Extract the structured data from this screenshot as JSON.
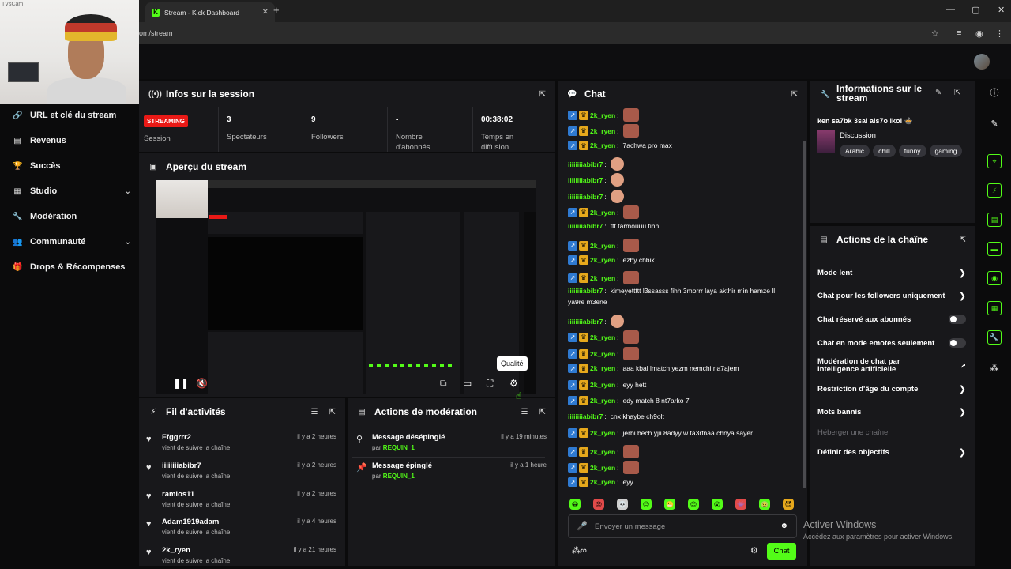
{
  "browser": {
    "tab_title": "Stream - Kick Dashboard",
    "tab_close": "✕",
    "new_tab": "+",
    "url": "om/stream",
    "window_controls": [
      "—",
      "▢",
      "✕"
    ]
  },
  "webcam": {
    "watermark": "TVsCam"
  },
  "sidebar": {
    "items": [
      {
        "label": "URL et clé du stream",
        "icon": "link-icon"
      },
      {
        "label": "Revenus",
        "icon": "bar-chart-icon"
      },
      {
        "label": "Succès",
        "icon": "trophy-icon"
      },
      {
        "label": "Studio",
        "icon": "studio-icon",
        "chevron": true
      },
      {
        "label": "Modération",
        "icon": "wrench-icon"
      },
      {
        "label": "Communauté",
        "icon": "community-icon",
        "chevron": true
      },
      {
        "label": "Drops & Récompenses",
        "icon": "gift-icon"
      }
    ]
  },
  "session": {
    "title": "Infos sur la session",
    "status": "STREAMING",
    "status_label": "Session",
    "stats": [
      {
        "value": "3",
        "label": "Spectateurs"
      },
      {
        "value": "9",
        "label": "Followers"
      },
      {
        "value": "-",
        "label": "Nombre d'abonnés"
      },
      {
        "value": "00:38:02",
        "label": "Temps en diffusion"
      }
    ]
  },
  "preview": {
    "title": "Aperçu du stream",
    "tooltip": "Qualité"
  },
  "activity": {
    "title": "Fil d'activités",
    "items": [
      {
        "name": "Ffggrrr2",
        "sub": "vient de suivre la chaîne",
        "time": "il y a 2 heures"
      },
      {
        "name": "iiiiiiiiabibr7",
        "sub": "vient de suivre la chaîne",
        "time": "il y a 2 heures"
      },
      {
        "name": "ramios11",
        "sub": "vient de suivre la chaîne",
        "time": "il y a 2 heures"
      },
      {
        "name": "Adam1919adam",
        "sub": "vient de suivre la chaîne",
        "time": "il y a 4 heures"
      },
      {
        "name": "2k_ryen",
        "sub": "vient de suivre la chaîne",
        "time": "il y a 21 heures"
      }
    ]
  },
  "moderation": {
    "title": "Actions de modération",
    "items": [
      {
        "action": "Message désépinglé",
        "by_prefix": "par",
        "by": "REQUIN_1",
        "time": "il y a 19 minutes"
      },
      {
        "action": "Message épinglé",
        "by_prefix": "par",
        "by": "REQUIN_1",
        "time": "il y a 1 heure"
      }
    ]
  },
  "chat": {
    "title": "Chat",
    "placeholder": "Envoyer un message",
    "send_label": "Chat",
    "colors": {
      "ryen": "#53fc18",
      "abibr": "#53fc18"
    },
    "messages": [
      {
        "user": "2k_ryen",
        "badges": true,
        "text": "",
        "emote": "photo"
      },
      {
        "user": "2k_ryen",
        "badges": true,
        "text": "",
        "emote": "photo"
      },
      {
        "user": "2k_ryen",
        "badges": true,
        "text": "7achwa pro max"
      },
      {
        "user": "iiiiiiiiabibr7",
        "badges": false,
        "text": "",
        "emote": "face"
      },
      {
        "user": "iiiiiiiiabibr7",
        "badges": false,
        "text": "",
        "emote": "face"
      },
      {
        "user": "iiiiiiiiabibr7",
        "badges": false,
        "text": "",
        "emote": "face"
      },
      {
        "user": "2k_ryen",
        "badges": true,
        "text": "",
        "emote": "photo"
      },
      {
        "user": "iiiiiiiiabibr7",
        "badges": false,
        "text": "ttt tarmouuu fihh"
      },
      {
        "user": "2k_ryen",
        "badges": true,
        "text": "",
        "emote": "photo"
      },
      {
        "user": "2k_ryen",
        "badges": true,
        "text": "ezby chbik"
      },
      {
        "user": "2k_ryen",
        "badges": true,
        "text": "",
        "emote": "photo"
      },
      {
        "user": "iiiiiiiiabibr7",
        "badges": false,
        "text": "kimeyettttt l3ssasss fihh 3morrr laya akthir min hamze ll",
        "text2": "ya9re m3ene"
      },
      {
        "user": "iiiiiiiiabibr7",
        "badges": false,
        "text": "",
        "emote": "face"
      },
      {
        "user": "2k_ryen",
        "badges": true,
        "text": "",
        "emote": "photo"
      },
      {
        "user": "2k_ryen",
        "badges": true,
        "text": "",
        "emote": "photo"
      },
      {
        "user": "2k_ryen",
        "badges": true,
        "text": "aaa kbal lmatch yezm nemchi na7ajem"
      },
      {
        "user": "2k_ryen",
        "badges": true,
        "text": "eyy hett"
      },
      {
        "user": "2k_ryen",
        "badges": true,
        "text": "edy match 8 nt7arko 7"
      },
      {
        "user": "iiiiiiiiabibr7",
        "badges": false,
        "text": "cnx khaybe ch9olt"
      },
      {
        "user": "2k_ryen",
        "badges": true,
        "text": "jerbi bech yjii 8adyy w ta3rfnaa chnya sayer"
      },
      {
        "user": "2k_ryen",
        "badges": true,
        "text": "",
        "emote": "photo"
      },
      {
        "user": "2k_ryen",
        "badges": true,
        "text": "",
        "emote": "photo"
      },
      {
        "user": "2k_ryen",
        "badges": true,
        "text": "eyy"
      }
    ]
  },
  "stream_info": {
    "title": "Informations sur le stream",
    "stream_title": "ken sa7bk 3sal als7o lkol 🍲",
    "category": "Discussion",
    "tags": [
      "Arabic",
      "chill",
      "funny",
      "gaming"
    ]
  },
  "channel_actions": {
    "title": "Actions de la chaîne",
    "items": [
      {
        "label": "Mode lent",
        "control": "arrow"
      },
      {
        "label": "Chat pour les followers uniquement",
        "control": "arrow"
      },
      {
        "label": "Chat réservé aux abonnés",
        "control": "toggle"
      },
      {
        "label": "Chat en mode emotes seulement",
        "control": "toggle"
      },
      {
        "label": "Modération de chat par intelligence artificielle",
        "control": "external"
      },
      {
        "label": "Restriction d'âge du compte",
        "control": "arrow"
      },
      {
        "label": "Mots bannis",
        "control": "arrow"
      },
      {
        "label": "Héberger une chaîne",
        "control": "none",
        "muted": true
      },
      {
        "label": "Définir des objectifs",
        "control": "arrow"
      }
    ]
  },
  "windows_watermark": {
    "line1": "Activer Windows",
    "line2": "Accédez aux paramètres pour activer Windows."
  },
  "accent": "#53fc18",
  "live_color": "#e91916"
}
